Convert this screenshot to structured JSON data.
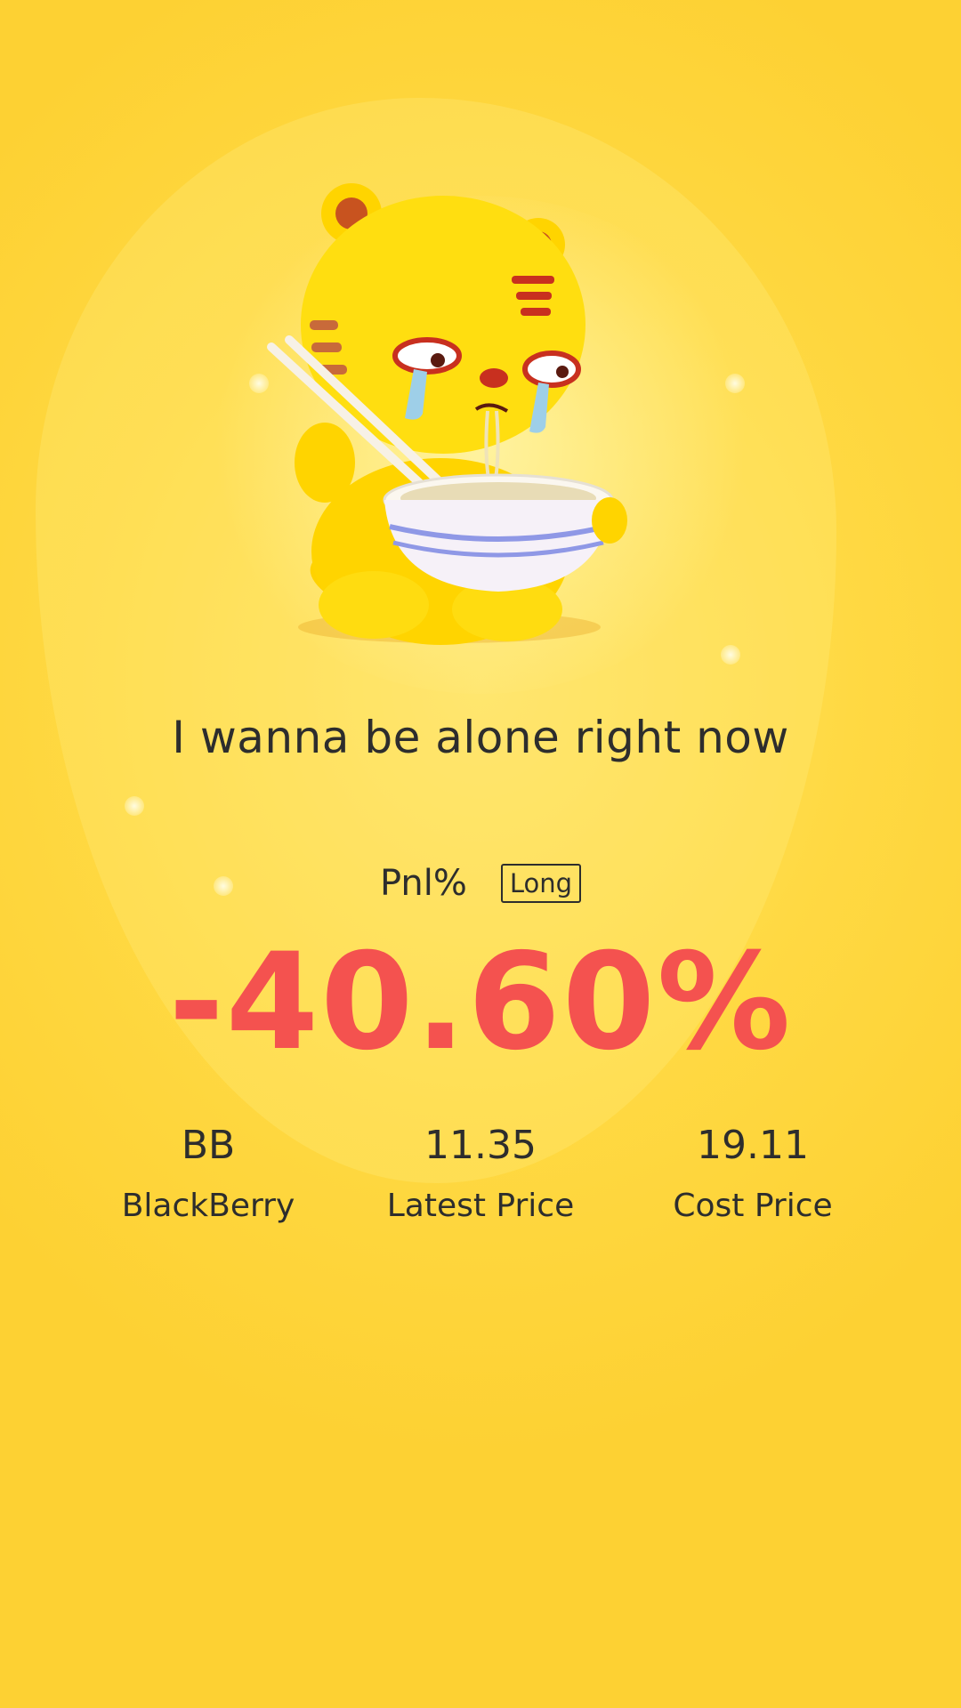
{
  "mood_text": "I wanna be alone right now",
  "pnl": {
    "label": "Pnl%",
    "direction": "Long",
    "value": "-40.60%",
    "value_color": "#f4524f"
  },
  "stats": [
    {
      "value": "BB",
      "label": "BlackBerry"
    },
    {
      "value": "11.35",
      "label": "Latest Price"
    },
    {
      "value": "19.11",
      "label": "Cost Price"
    }
  ],
  "colors": {
    "background": "#ffd943",
    "text": "#2d2d2d"
  },
  "illustration": "crying-tiger-eating-noodles"
}
